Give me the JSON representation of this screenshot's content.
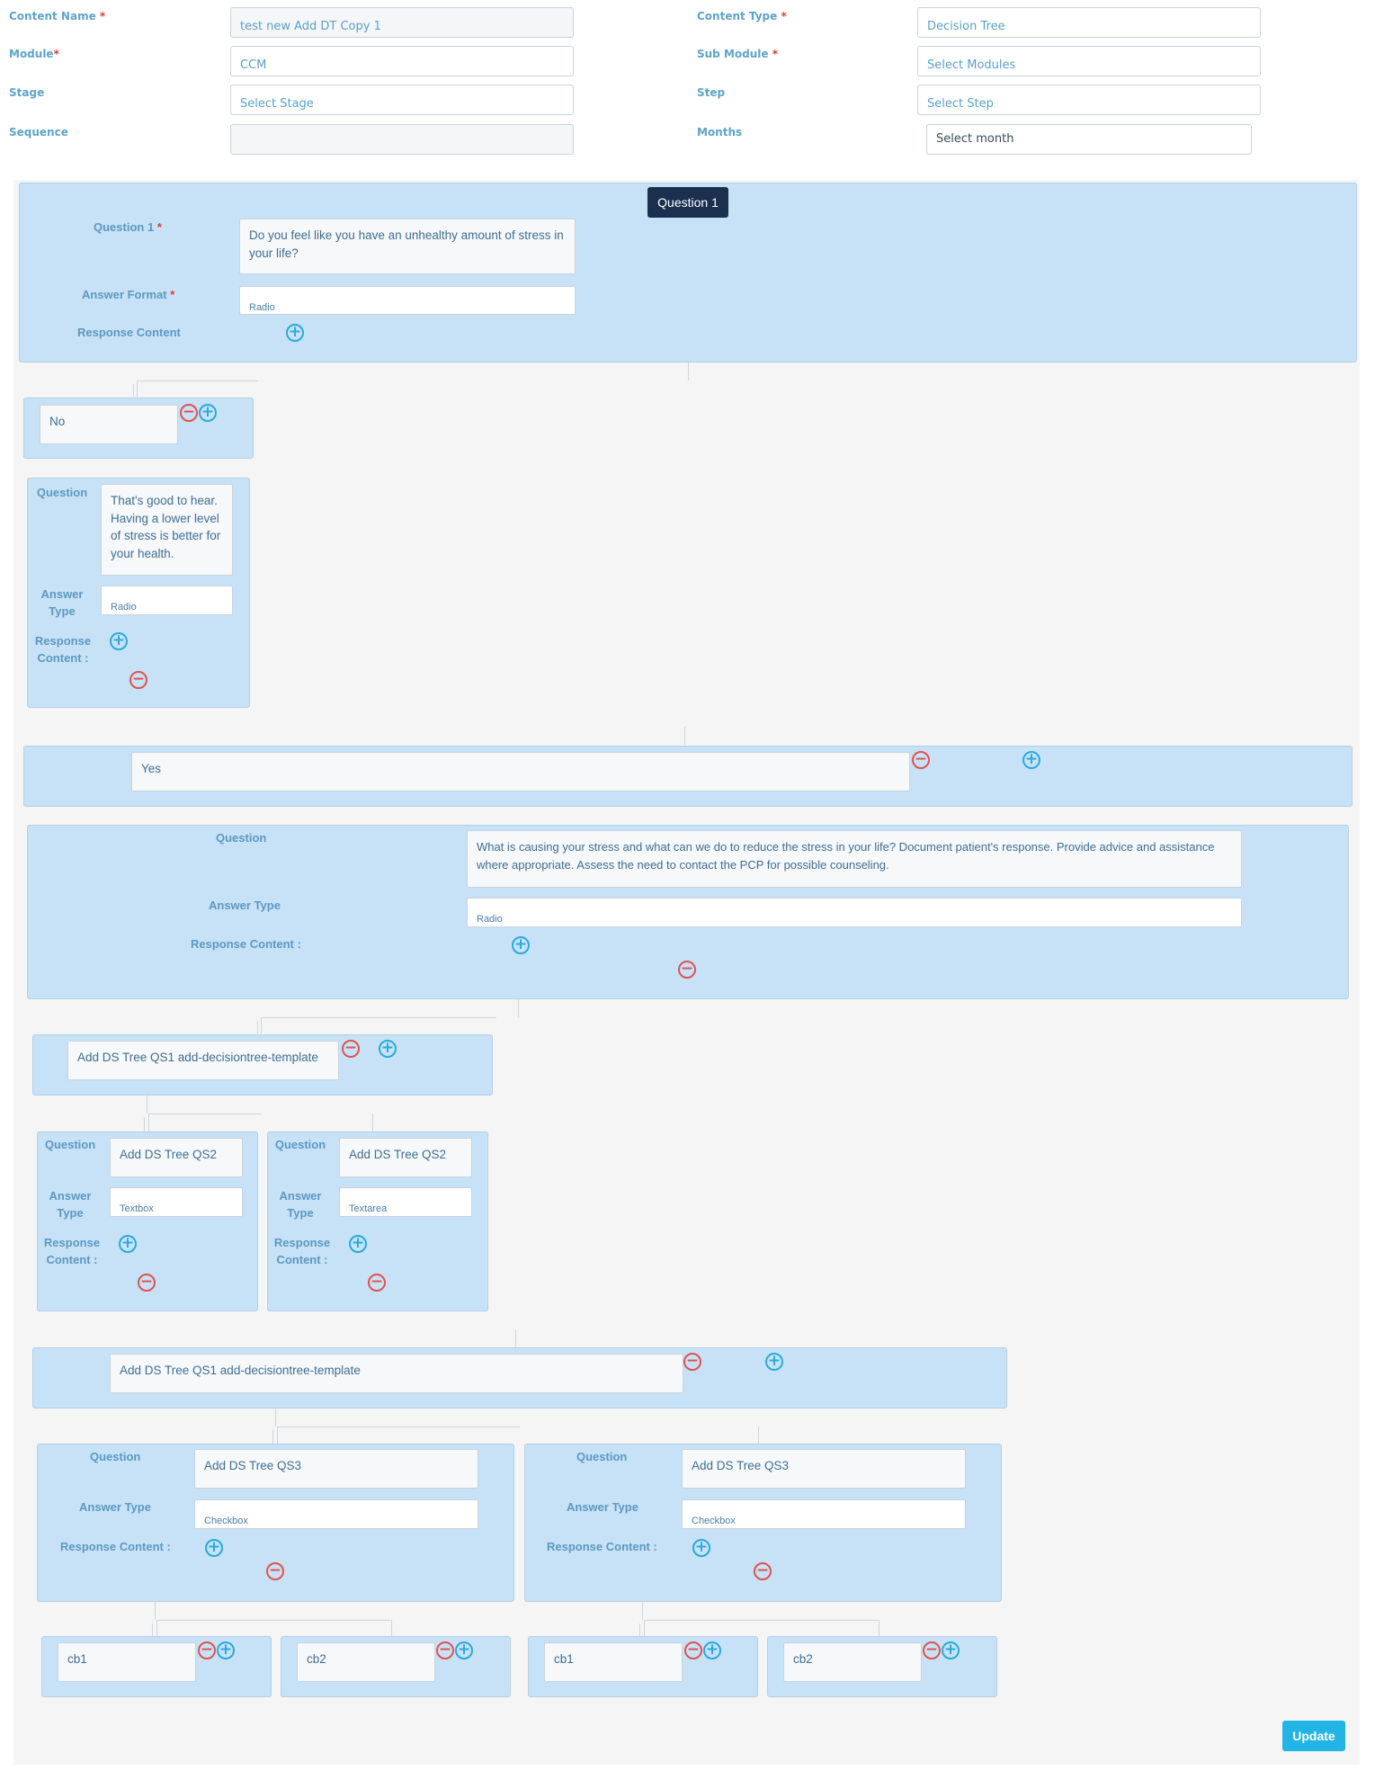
{
  "form": {
    "content_name_label": "Content Name",
    "content_name_value": "test new Add DT Copy 1",
    "content_type_label": "Content Type",
    "content_type_value": "Decision Tree",
    "module_label": "Module",
    "module_value": "CCM",
    "sub_module_label": "Sub Module",
    "sub_module_placeholder": "Select Modules",
    "stage_label": "Stage",
    "stage_placeholder": "Select Stage",
    "step_label": "Step",
    "step_placeholder": "Select Step",
    "sequence_label": "Sequence",
    "sequence_value": "",
    "months_label": "Months",
    "months_placeholder": "Select month",
    "required_mark": "*"
  },
  "root": {
    "badge": "Question 1",
    "question_label": "Question 1",
    "question_text": "Do you feel like you have an unhealthy amount of stress in your life?",
    "answer_format_label": "Answer Format",
    "answer_format_value": "Radio",
    "response_content_label": "Response Content"
  },
  "no_branch": {
    "answer": "No",
    "question_label": "Question",
    "question_text": "That's good to hear. Having a lower level of stress is better for your health.",
    "answer_type_label": "Answer Type",
    "answer_type_value": "Radio",
    "response_label": "Response Content :"
  },
  "yes_branch": {
    "answer": "Yes",
    "question_label": "Question",
    "question_text": "What is causing your stress and what can we do to reduce the stress in your life? Document patient's response. Provide advice and assistance where appropriate. Assess the need to contact the PCP for possible counseling.",
    "answer_type_label": "Answer Type",
    "answer_type_value": "Radio",
    "response_label": "Response Content :"
  },
  "sub1": {
    "answer": "Add DS Tree QS1 add-decisiontree-template",
    "left": {
      "question_label": "Question",
      "question_text": "Add DS Tree QS2",
      "answer_type_label": "Answer Type",
      "answer_type_value": "Textbox",
      "response_label": "Response Content :"
    },
    "right": {
      "question_label": "Question",
      "question_text": "Add DS Tree QS2",
      "answer_type_label": "Answer Type",
      "answer_type_value": "Textarea",
      "response_label": "Response Content :"
    }
  },
  "sub2": {
    "answer": "Add DS Tree QS1 add-decisiontree-template",
    "left": {
      "question_label": "Question",
      "question_text": "Add DS Tree QS3",
      "answer_type_label": "Answer Type",
      "answer_type_value": "Checkbox",
      "response_label": "Response Content :"
    },
    "right": {
      "question_label": "Question",
      "question_text": "Add DS Tree QS3",
      "answer_type_label": "Answer Type",
      "answer_type_value": "Checkbox",
      "response_label": "Response Content :"
    }
  },
  "leaves": [
    "cb1",
    "cb2",
    "cb1",
    "cb2"
  ],
  "icons": {
    "plus": "+",
    "minus": "−"
  },
  "update_label": "Update",
  "colors": {
    "panel": "#c7e2f6",
    "badge": "#1b2f4f",
    "update": "#23b4e6",
    "plus": "#29aadc",
    "minus": "#e05252"
  }
}
